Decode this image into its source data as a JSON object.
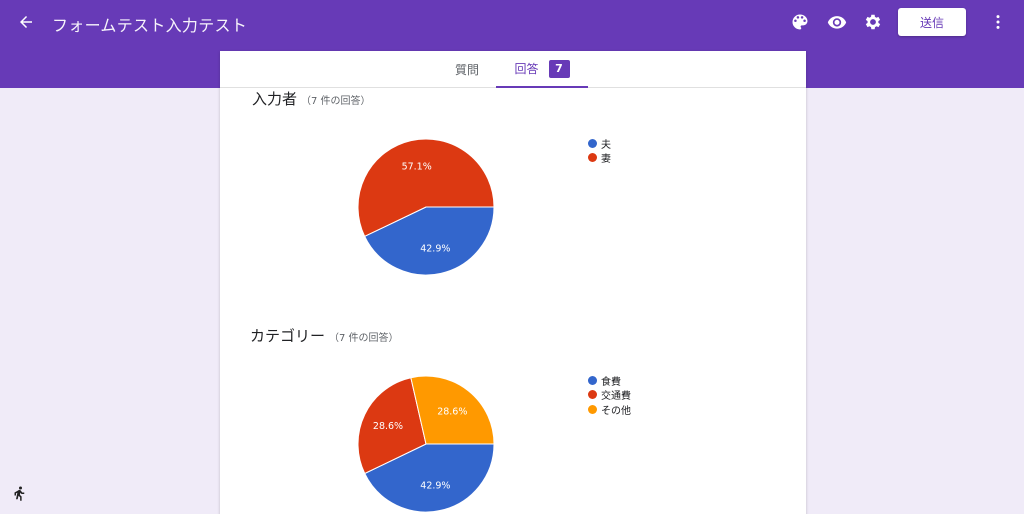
{
  "header": {
    "title": "フォームテスト入力テスト",
    "send_label": "送信",
    "icons": [
      "back-arrow-icon",
      "palette-icon",
      "eye-icon",
      "gear-icon",
      "more-vert-icon"
    ]
  },
  "tabs": {
    "questions_label": "質問",
    "responses_label": "回答",
    "responses_count": "7"
  },
  "colors": {
    "header_bg": "#673ab7",
    "page_bg": "#f0ebf8",
    "blue": "#3366cc",
    "red": "#dc3912",
    "orange": "#ff9900"
  },
  "questions": [
    {
      "title": "入力者",
      "count_text": "（7 件の回答）",
      "legend": [
        "夫",
        "妻"
      ]
    },
    {
      "title": "カテゴリー",
      "count_text": "（7 件の回答）",
      "legend": [
        "食費",
        "交通費",
        "その他"
      ]
    }
  ],
  "chart_data": [
    {
      "type": "pie",
      "title": "入力者",
      "labels": [
        "夫",
        "妻"
      ],
      "values": [
        42.9,
        57.1
      ],
      "data_labels": [
        "42.9%",
        "57.1%"
      ],
      "colors": [
        "#3366cc",
        "#dc3912"
      ],
      "legend": "right"
    },
    {
      "type": "pie",
      "title": "カテゴリー",
      "labels": [
        "食費",
        "交通費",
        "その他"
      ],
      "values": [
        42.9,
        28.6,
        28.6
      ],
      "data_labels": [
        "42.9%",
        "28.6%",
        "28.6%"
      ],
      "colors": [
        "#3366cc",
        "#dc3912",
        "#ff9900"
      ],
      "legend": "right"
    }
  ]
}
